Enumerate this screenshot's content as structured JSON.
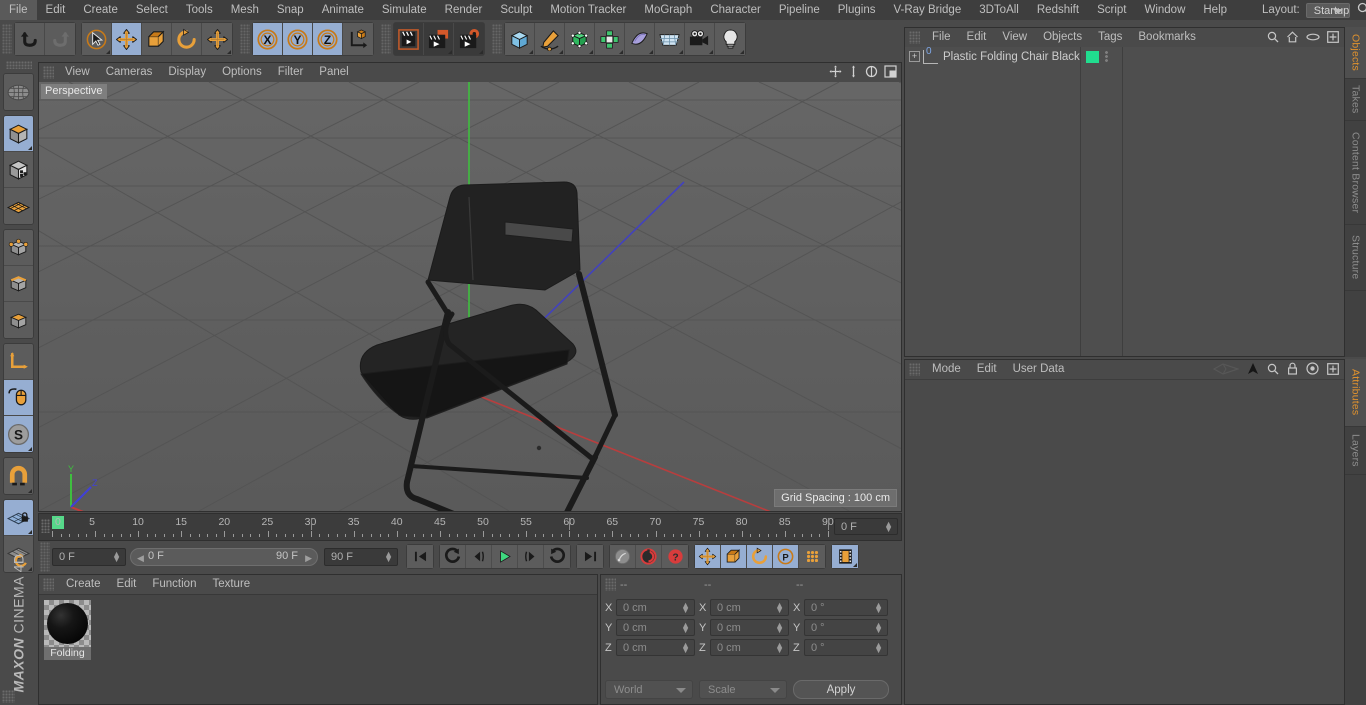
{
  "app": {
    "title": "Cinema 4D",
    "brand_top": "MAXON",
    "brand_bottom": "CINEMA 4D"
  },
  "menubar": {
    "items": [
      "File",
      "Edit",
      "Create",
      "Select",
      "Tools",
      "Mesh",
      "Snap",
      "Animate",
      "Simulate",
      "Render",
      "Sculpt",
      "Motion Tracker",
      "MoGraph",
      "Character",
      "Pipeline",
      "Plugins",
      "V-Ray Bridge",
      "3DToAll",
      "Redshift",
      "Script",
      "Window",
      "Help"
    ],
    "layout_label": "Layout:",
    "layout_value": "Startup",
    "search_icon": "search-icon"
  },
  "toolbar": {
    "groups": [
      {
        "name": "history",
        "buttons": [
          {
            "name": "undo-button",
            "icon": "undo-arrow-icon",
            "selected": false,
            "corner": false
          },
          {
            "name": "redo-button",
            "icon": "redo-arrow-icon",
            "selected": false,
            "corner": false
          }
        ]
      },
      {
        "name": "transform-tools",
        "buttons": [
          {
            "name": "live-selection-tool",
            "icon": "cursor-circle-icon",
            "selected": false,
            "corner": true
          },
          {
            "name": "move-tool",
            "icon": "move-arrows-icon",
            "selected": true,
            "corner": false
          },
          {
            "name": "scale-tool",
            "icon": "scale-box-icon",
            "selected": false,
            "corner": false
          },
          {
            "name": "rotate-tool",
            "icon": "rotate-circle-icon",
            "selected": false,
            "corner": false
          },
          {
            "name": "dynamic-place-tool",
            "icon": "move-arrows-icon",
            "selected": false,
            "corner": true
          }
        ]
      },
      {
        "name": "axis-locks",
        "buttons": [
          {
            "name": "lock-x-axis-button",
            "label": "X",
            "selected": true,
            "corner": false
          },
          {
            "name": "lock-y-axis-button",
            "label": "Y",
            "selected": true,
            "corner": false
          },
          {
            "name": "lock-z-axis-button",
            "label": "Z",
            "selected": true,
            "corner": false
          },
          {
            "name": "world-object-coordinates-button",
            "icon": "axis-cube-icon",
            "selected": false,
            "corner": false
          }
        ]
      },
      {
        "name": "render-tools",
        "buttons": [
          {
            "name": "render-view-button",
            "icon": "clapper-icon",
            "selected": false,
            "corner": false
          },
          {
            "name": "render-to-picture-viewer-button",
            "icon": "clapper-picture-icon",
            "selected": false,
            "corner": true
          },
          {
            "name": "render-settings-button",
            "icon": "clapper-gear-icon",
            "selected": false,
            "corner": true
          }
        ]
      },
      {
        "name": "create-tools",
        "buttons": [
          {
            "name": "add-cube-button",
            "icon": "cube-icon",
            "selected": false,
            "corner": true
          },
          {
            "name": "add-spline-button",
            "icon": "pen-spline-icon",
            "selected": false,
            "corner": true
          },
          {
            "name": "add-generator-button",
            "icon": "generator-cube-icon",
            "selected": false,
            "corner": true
          },
          {
            "name": "add-deformer-button",
            "icon": "deformer-icon",
            "selected": false,
            "corner": true
          },
          {
            "name": "add-scene-object-button",
            "icon": "bend-plane-icon",
            "selected": false,
            "corner": true
          },
          {
            "name": "add-environment-button",
            "icon": "grid-floor-icon",
            "selected": false,
            "corner": true
          },
          {
            "name": "add-camera-button",
            "icon": "camera-icon",
            "selected": false,
            "corner": true
          },
          {
            "name": "add-light-button",
            "icon": "lightbulb-icon",
            "selected": false,
            "corner": true
          }
        ]
      }
    ]
  },
  "lefttools": {
    "buttons": [
      {
        "name": "undo-view-button",
        "icon": "globe-wire-icon",
        "selected": false,
        "corner": false
      },
      {
        "name": "model-mode-button",
        "icon": "cube-orange-icon",
        "selected": true,
        "corner": true
      },
      {
        "name": "texture-mode-button",
        "icon": "checker-cube-icon",
        "selected": false,
        "corner": false
      },
      {
        "name": "axis-mode-button",
        "icon": "orange-grid-plane-icon",
        "selected": false,
        "corner": false
      },
      {
        "name": "points-mode-button",
        "icon": "points-cube-icon",
        "selected": false,
        "corner": false
      },
      {
        "name": "edges-mode-button",
        "icon": "edges-cube-icon",
        "selected": false,
        "corner": false
      },
      {
        "name": "polygons-mode-button",
        "icon": "polygons-cube-icon",
        "selected": false,
        "corner": false
      },
      {
        "name": "enable-axis-button",
        "icon": "axis-l-icon",
        "selected": false,
        "corner": false
      },
      {
        "name": "viewport-solo-button",
        "icon": "mouse-icon",
        "selected": true,
        "corner": false
      },
      {
        "name": "enable-snap-button",
        "icon": "snap-s-icon",
        "selected": true,
        "corner": true
      },
      {
        "name": "magnet-tool-button",
        "icon": "magnet-icon",
        "selected": false,
        "corner": true
      },
      {
        "name": "workplane-lock-button",
        "icon": "workplane-lock-icon",
        "selected": true,
        "corner": true
      },
      {
        "name": "workplane-rotate-button",
        "icon": "workplane-rotate-icon",
        "selected": false,
        "corner": true
      }
    ]
  },
  "viewport": {
    "menu": [
      "View",
      "Cameras",
      "Display",
      "Options",
      "Filter",
      "Panel"
    ],
    "label": "Perspective",
    "grid_spacing": "Grid Spacing : 100 cm",
    "icons": [
      "pan-icon",
      "dolly-icon",
      "orbit-icon",
      "maximize-icon"
    ],
    "axis_gizmo": {
      "x": "X",
      "y": "Y",
      "z": "Z"
    },
    "colors": {
      "background": "#606060",
      "x_axis": "#c83c3c",
      "y_axis": "#3cc83c",
      "z_axis": "#4040d8",
      "object": "#1f1f1f"
    }
  },
  "timeline": {
    "ticks": [
      "0",
      "5",
      "10",
      "15",
      "20",
      "25",
      "30",
      "35",
      "40",
      "45",
      "50",
      "55",
      "60",
      "65",
      "70",
      "75",
      "80",
      "85",
      "90"
    ],
    "current_frame_field": "0 F"
  },
  "transport": {
    "start_field": "0 F",
    "range_start": "0 F",
    "range_end": "90 F",
    "end_field": "90 F",
    "buttons": [
      {
        "name": "go-to-start-button",
        "icon": "skip-start-icon",
        "selected": false
      },
      {
        "name": "go-back-keyframe-button",
        "icon": "prev-key-icon",
        "selected": false
      },
      {
        "name": "step-back-button",
        "icon": "step-back-icon",
        "selected": false
      },
      {
        "name": "play-button",
        "icon": "play-icon",
        "selected": false
      },
      {
        "name": "step-forward-button",
        "icon": "step-forward-icon",
        "selected": false
      },
      {
        "name": "go-forward-keyframe-button",
        "icon": "next-key-icon",
        "selected": false
      },
      {
        "name": "go-to-end-button",
        "icon": "skip-end-icon",
        "selected": false
      },
      {
        "name": "record-active-objects-button",
        "icon": "key-icon",
        "selected": false
      },
      {
        "name": "autokeying-button",
        "icon": "red-circle-icon",
        "selected": false
      },
      {
        "name": "keyframe-selection-button",
        "icon": "red-question-icon",
        "selected": false
      },
      {
        "name": "position-key-button",
        "icon": "move-arrows-icon",
        "selected": true
      },
      {
        "name": "scale-key-button",
        "icon": "scale-box-icon",
        "selected": true
      },
      {
        "name": "rotation-key-button",
        "icon": "rotate-circle-icon",
        "selected": true
      },
      {
        "name": "parameter-key-button",
        "icon": "param-p-icon",
        "selected": true
      },
      {
        "name": "point-level-animation-button",
        "icon": "dots-grid-icon",
        "selected": false
      },
      {
        "name": "timeline-toggle-button",
        "icon": "filmstrip-icon",
        "selected": true
      }
    ]
  },
  "material_manager": {
    "menu": [
      "Create",
      "Edit",
      "Function",
      "Texture"
    ],
    "materials": [
      {
        "name": "Folding",
        "color": "#0c0c0c"
      }
    ]
  },
  "coordinates": {
    "headers": [
      "--",
      "--",
      "--"
    ],
    "rows": [
      {
        "axis": "X",
        "position": "0 cm",
        "size": "0 cm",
        "rotation": "0 °"
      },
      {
        "axis": "Y",
        "position": "0 cm",
        "size": "0 cm",
        "rotation": "0 °"
      },
      {
        "axis": "Z",
        "position": "0 cm",
        "size": "0 cm",
        "rotation": "0 °"
      }
    ],
    "coord_system": "World",
    "mode": "Scale",
    "apply_label": "Apply"
  },
  "object_manager": {
    "menu": [
      "File",
      "Edit",
      "View",
      "Objects",
      "Tags",
      "Bookmarks"
    ],
    "icons": [
      "search-icon",
      "home-icon",
      "ellipse-icon",
      "plus-box-icon"
    ],
    "objects": [
      {
        "name": "Plastic Folding Chair Black",
        "level_badge": "0",
        "swatch_color": "#21dd8f",
        "expandable": true
      }
    ]
  },
  "attribute_manager": {
    "menu": [
      "Mode",
      "Edit",
      "User Data"
    ],
    "icons": [
      "history-icon",
      "arrow-up-icon",
      "search-icon",
      "lock-icon",
      "target-icon",
      "plus-box-icon"
    ]
  },
  "right_tabs_top": [
    "Objects",
    "Takes",
    "Content Browser",
    "Structure"
  ],
  "right_tabs_bottom": [
    "Attributes",
    "Layers"
  ]
}
